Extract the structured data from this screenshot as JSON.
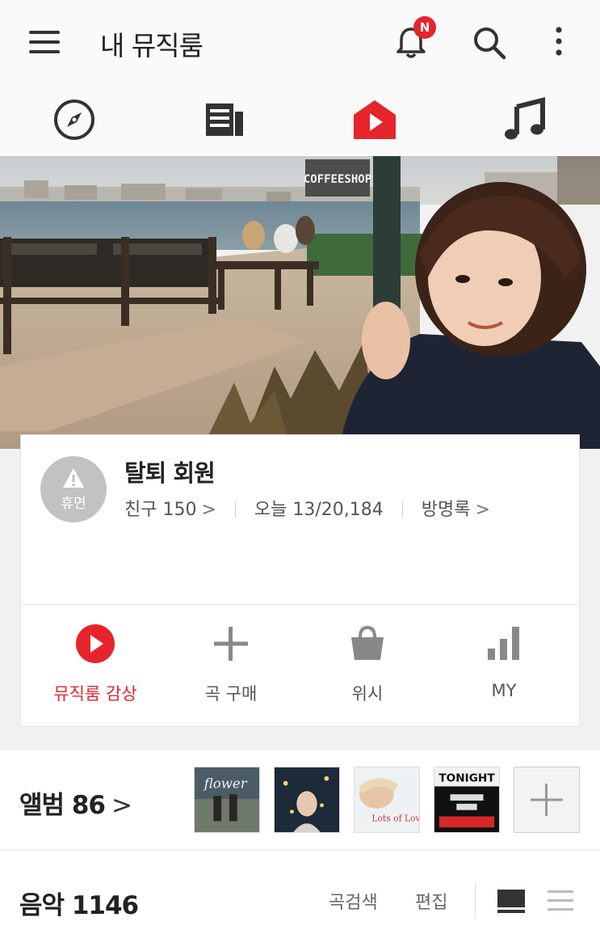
{
  "header": {
    "title": "내 뮤직룸",
    "notification_badge": "N"
  },
  "nav": {
    "tabs": [
      "explore-icon",
      "news-icon",
      "musicroom-home-icon",
      "music-note-icon"
    ],
    "active_tab": "musicroom-home-icon",
    "accent_color": "#e6242b"
  },
  "cover": {
    "sign_text": "COFFEESHOP"
  },
  "profile": {
    "status": "휴면",
    "name": "탈퇴 회원",
    "friends": "친구 150",
    "today": "오늘 13/20,184",
    "guestbook": "방명록"
  },
  "actions": [
    {
      "label": "뮤직룸 감상",
      "icon": "play-circle-icon"
    },
    {
      "label": "곡 구매",
      "icon": "plus-icon"
    },
    {
      "label": "위시",
      "icon": "shopping-bag-icon"
    },
    {
      "label": "MY",
      "icon": "bar-chart-icon"
    }
  ],
  "albums": {
    "title": "앨범 86",
    "covers": [
      {
        "text": "flower"
      },
      {
        "text": ""
      },
      {
        "text": "Lots of Love"
      },
      {
        "text": "TONIGHT"
      }
    ]
  },
  "music": {
    "title": "음악 1146",
    "search_label": "곡검색",
    "edit_label": "편집"
  }
}
